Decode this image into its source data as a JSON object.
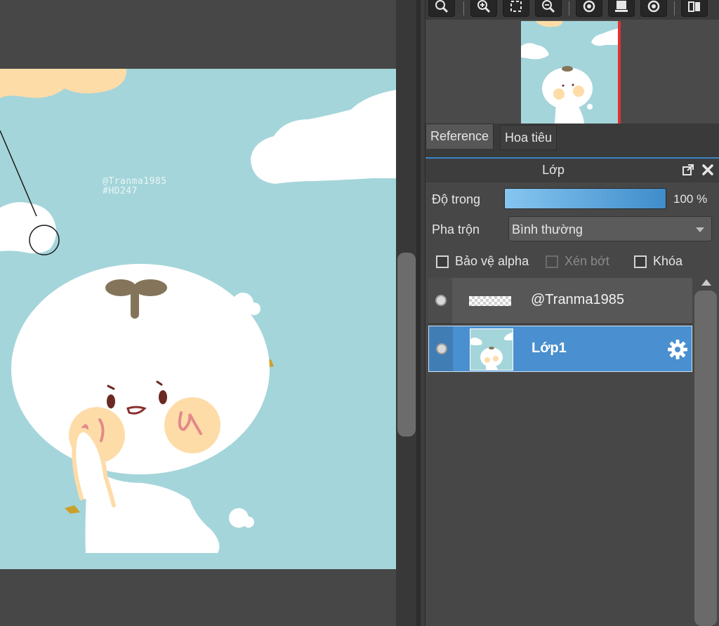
{
  "canvas": {
    "watermark_line1": "@Tranma1985",
    "watermark_line2": "#HD247",
    "background_color": "#a4d5da"
  },
  "toolbar": {
    "buttons": [
      {
        "icon": "zoom-icon"
      },
      {
        "icon": "zoom-in-icon"
      },
      {
        "icon": "fit-screen-icon"
      },
      {
        "icon": "zoom-out-icon"
      },
      {
        "icon": "rotate-left-icon"
      },
      {
        "icon": "reset-view-icon"
      },
      {
        "icon": "rotate-right-icon"
      },
      {
        "icon": "flip-icon"
      }
    ]
  },
  "tabs": {
    "reference": "Reference",
    "navigator": "Hoa tiêu"
  },
  "layers_panel": {
    "title": "Lớp",
    "opacity_label": "Độ trong",
    "opacity_value": "100 %",
    "opacity_fraction": 1.0,
    "blend_label": "Pha trộn",
    "blend_value": "Bình thường",
    "protect_alpha": "Bảo vệ alpha",
    "clipping": "Xén bớt",
    "lock": "Khóa",
    "layers": [
      {
        "name": "@Tranma1985",
        "selected": false
      },
      {
        "name": "Lớp1",
        "selected": true
      }
    ],
    "accent_color": "#4a8fcf"
  }
}
